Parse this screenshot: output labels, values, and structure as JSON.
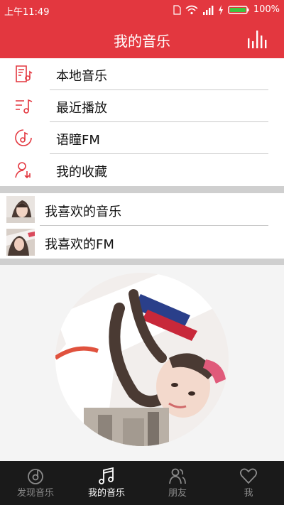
{
  "status_bar": {
    "time": "上午11:49",
    "battery": "100%",
    "icons": [
      "sim-icon",
      "wifi-icon",
      "signal-icon",
      "charging-icon",
      "battery-icon"
    ]
  },
  "header": {
    "title": "我的音乐",
    "right_icon": "bar-chart-icon"
  },
  "menu": [
    {
      "label": "本地音乐",
      "icon": "local-music-icon"
    },
    {
      "label": "最近播放",
      "icon": "recent-play-icon"
    },
    {
      "label": "语瞳FM",
      "icon": "fm-disc-icon"
    },
    {
      "label": "我的收藏",
      "icon": "favorites-user-icon"
    }
  ],
  "favorites": [
    {
      "label": "我喜欢的音乐",
      "icon": "cover-thumbnail"
    },
    {
      "label": "我喜欢的FM",
      "icon": "cover-thumbnail"
    }
  ],
  "tabs": [
    {
      "label": "发现音乐",
      "icon": "discover-music-icon",
      "active": false
    },
    {
      "label": "我的音乐",
      "icon": "music-note-icon",
      "active": true
    },
    {
      "label": "朋友",
      "icon": "friends-icon",
      "active": false
    },
    {
      "label": "我",
      "icon": "heart-icon",
      "active": false
    }
  ],
  "colors": {
    "accent": "#e3373f",
    "tabbar": "#1a1a1a",
    "divider": "#c9c9c9",
    "section_gap": "#cfcfcf"
  }
}
